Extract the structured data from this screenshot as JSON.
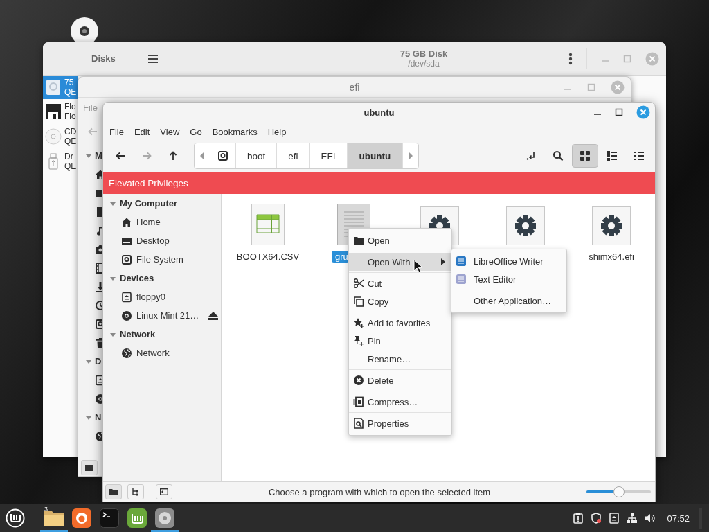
{
  "disks_window": {
    "title": "Disks",
    "disk_title": "75 GB Disk",
    "disk_subtitle": "/dev/sda",
    "drives": [
      {
        "kind": "hard-disk",
        "name": "75",
        "detail": "QE",
        "selected": true
      },
      {
        "kind": "floppy",
        "name": "Flo",
        "detail": "Flo",
        "selected": false
      },
      {
        "kind": "optical",
        "name": "CD",
        "detail": "QE",
        "selected": false
      },
      {
        "kind": "usb",
        "name": "Dr",
        "detail": "QE",
        "selected": false
      }
    ]
  },
  "efi_window": {
    "title": "efi",
    "menu": [
      "File"
    ],
    "sidebar": [
      {
        "heading": "M",
        "expanded": true,
        "items": [
          {
            "kind": "home"
          },
          {
            "kind": "desktop"
          },
          {
            "kind": "documents"
          },
          {
            "kind": "music"
          },
          {
            "kind": "pictures"
          },
          {
            "kind": "videos"
          },
          {
            "kind": "downloads"
          },
          {
            "kind": "recent"
          },
          {
            "kind": "drive"
          },
          {
            "kind": "trash"
          }
        ]
      },
      {
        "heading": "D",
        "expanded": true,
        "items": [
          {
            "kind": "floppy"
          },
          {
            "kind": "optical"
          }
        ]
      },
      {
        "heading": "N",
        "expanded": true,
        "items": [
          {
            "kind": "network"
          }
        ]
      }
    ]
  },
  "file_manager": {
    "title": "ubuntu",
    "menu": [
      "File",
      "Edit",
      "View",
      "Go",
      "Bookmarks",
      "Help"
    ],
    "path": [
      {
        "label": "boot",
        "selected": false
      },
      {
        "label": "efi",
        "selected": false
      },
      {
        "label": "EFI",
        "selected": false
      },
      {
        "label": "ubuntu",
        "selected": true
      }
    ],
    "views": [
      {
        "kind": "icons",
        "selected": true
      },
      {
        "kind": "list",
        "selected": false
      },
      {
        "kind": "compact",
        "selected": false
      }
    ],
    "banner": "Elevated Privileges",
    "sidebar": [
      {
        "heading": "My Computer",
        "expanded": true,
        "items": [
          {
            "kind": "home",
            "label": "Home",
            "selected": false
          },
          {
            "kind": "desktop",
            "label": "Desktop",
            "selected": false
          },
          {
            "kind": "drive",
            "label": "File System",
            "selected": true
          }
        ]
      },
      {
        "heading": "Devices",
        "expanded": true,
        "items": [
          {
            "kind": "floppy",
            "label": "floppy0",
            "selected": false
          },
          {
            "kind": "optical",
            "label": "Linux Mint 21…",
            "selected": false,
            "ejectable": true
          }
        ]
      },
      {
        "heading": "Network",
        "expanded": true,
        "items": [
          {
            "kind": "network",
            "label": "Network",
            "selected": false
          }
        ]
      }
    ],
    "files": [
      {
        "kind": "spreadsheet",
        "name": "BOOTX64.CSV",
        "selected": false
      },
      {
        "kind": "text",
        "name": "gru",
        "selected": true
      },
      {
        "kind": "executable"
      },
      {
        "kind": "executable"
      },
      {
        "kind": "executable",
        "name": "shimx64.efi",
        "selected": false
      }
    ],
    "status": "Choose a program with which to open the selected item",
    "zoom": {
      "level": 0.5
    }
  },
  "context_menu": {
    "groups": [
      [
        {
          "kind": "open",
          "label": "Open",
          "selected": false
        }
      ],
      [
        {
          "kind": "none",
          "label": "Open With",
          "selected": true,
          "submenu": true
        }
      ],
      [
        {
          "kind": "cut",
          "label": "Cut",
          "selected": false
        },
        {
          "kind": "copy",
          "label": "Copy",
          "selected": false
        }
      ],
      [
        {
          "kind": "favorite",
          "label": "Add to favorites",
          "selected": false
        },
        {
          "kind": "pin",
          "label": "Pin",
          "selected": false
        },
        {
          "kind": "none",
          "label": "Rename…",
          "selected": false
        }
      ],
      [
        {
          "kind": "delete",
          "label": "Delete",
          "selected": false
        }
      ],
      [
        {
          "kind": "compress",
          "label": "Compress…",
          "selected": false
        }
      ],
      [
        {
          "kind": "properties",
          "label": "Properties",
          "selected": false
        }
      ]
    ]
  },
  "submenu": {
    "groups": [
      [
        {
          "kind": "writer",
          "label": "LibreOffice Writer",
          "selected": false
        },
        {
          "kind": "text-editor",
          "label": "Text Editor",
          "selected": false
        }
      ],
      [
        {
          "kind": "none",
          "label": "Other Application…",
          "selected": false
        }
      ]
    ]
  },
  "taskbar": {
    "apps": [
      {
        "kind": "files",
        "badge": "3",
        "active": true
      },
      {
        "kind": "browser",
        "active": false
      },
      {
        "kind": "terminal",
        "active": false
      },
      {
        "kind": "update-manager",
        "active": false
      },
      {
        "kind": "disks",
        "active": true
      }
    ],
    "tray": [
      {
        "kind": "clipboard"
      },
      {
        "kind": "shield"
      },
      {
        "kind": "notes"
      },
      {
        "kind": "network"
      },
      {
        "kind": "volume"
      }
    ],
    "clock": "07:52"
  }
}
